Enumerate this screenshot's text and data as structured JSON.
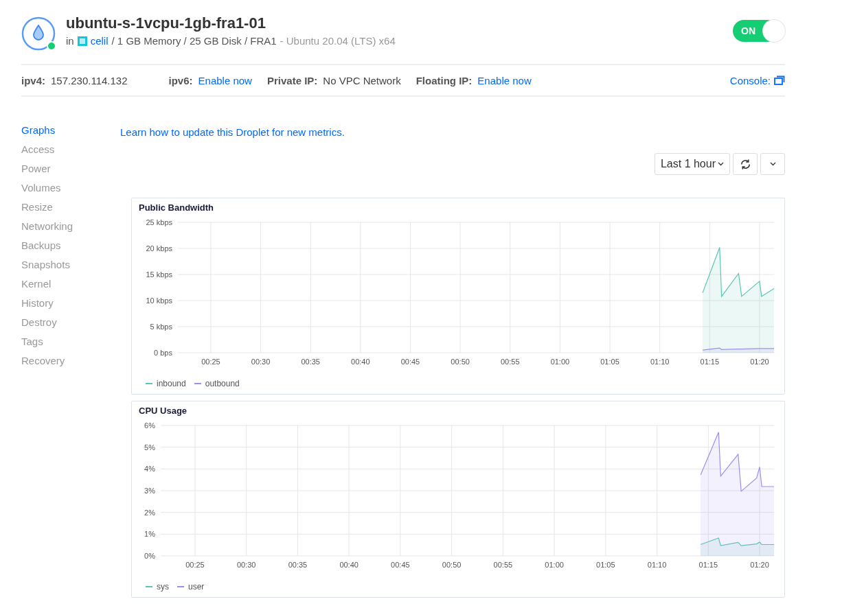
{
  "header": {
    "name": "ubuntu-s-1vcpu-1gb-fra1-01",
    "in_label": "in",
    "project": "celil",
    "specs": "/ 1 GB Memory / 25 GB Disk / FRA1",
    "image": "- Ubuntu 20.04 (LTS) x64",
    "power": {
      "label": "ON",
      "on": true
    }
  },
  "network": {
    "items": [
      {
        "label": "ipv4:",
        "value": "157.230.114.132",
        "kind": "text"
      },
      {
        "label": "ipv6:",
        "value": "Enable now",
        "kind": "link"
      },
      {
        "label": "Private IP:",
        "value": "No VPC Network",
        "kind": "text"
      },
      {
        "label": "Floating IP:",
        "value": "Enable now",
        "kind": "link"
      }
    ],
    "console": "Console:"
  },
  "sidebar": {
    "items": [
      {
        "label": "Graphs",
        "selected": true
      },
      {
        "label": "Access",
        "selected": false
      },
      {
        "label": "Power",
        "selected": false
      },
      {
        "label": "Volumes",
        "selected": false
      },
      {
        "label": "Resize",
        "selected": false
      },
      {
        "label": "Networking",
        "selected": false
      },
      {
        "label": "Backups",
        "selected": false
      },
      {
        "label": "Snapshots",
        "selected": false
      },
      {
        "label": "Kernel",
        "selected": false
      },
      {
        "label": "History",
        "selected": false
      },
      {
        "label": "Destroy",
        "selected": false
      },
      {
        "label": "Tags",
        "selected": false
      },
      {
        "label": "Recovery",
        "selected": false
      }
    ]
  },
  "main": {
    "update_link": "Learn how to update this Droplet for new metrics.",
    "range": "Last 1 hour",
    "charts": [
      {
        "chart_data": {
          "type": "area",
          "grid": true,
          "title": "Public Bandwidth",
          "x": [
            74.3,
            76.0,
            76.2,
            77.9,
            78.2,
            80.0,
            80.2,
            81.45
          ],
          "series": [
            {
              "name": "inbound",
              "color": "#5cc6b4",
              "values": [
                11.5,
                20.2,
                10.8,
                15.2,
                10.8,
                13.7,
                10.8,
                12.3
              ]
            },
            {
              "name": "outbound",
              "color": "#9d8ff0",
              "values": [
                0.5,
                0.9,
                0.6,
                0.7,
                0.7,
                0.8,
                0.8,
                0.8
              ]
            }
          ],
          "xlim": [
            21.7,
            81.45
          ],
          "ylim": [
            0,
            25
          ],
          "xticks": [
            {
              "value": 25,
              "label": "00:25"
            },
            {
              "value": 30,
              "label": "00:30"
            },
            {
              "value": 35,
              "label": "00:35"
            },
            {
              "value": 40,
              "label": "00:40"
            },
            {
              "value": 45,
              "label": "00:45"
            },
            {
              "value": 50,
              "label": "00:50"
            },
            {
              "value": 55,
              "label": "00:55"
            },
            {
              "value": 60,
              "label": "01:00"
            },
            {
              "value": 65,
              "label": "01:05"
            },
            {
              "value": 70,
              "label": "01:10"
            },
            {
              "value": 75,
              "label": "01:15"
            },
            {
              "value": 80,
              "label": "01:20"
            }
          ],
          "yticks": [
            {
              "value": 0,
              "label": "0 bps"
            },
            {
              "value": 5,
              "label": "5 kbps"
            },
            {
              "value": 10,
              "label": "10 kbps"
            },
            {
              "value": 15,
              "label": "15 kbps"
            },
            {
              "value": 20,
              "label": "20 kbps"
            },
            {
              "value": 25,
              "label": "25 kbps"
            }
          ]
        }
      },
      {
        "chart_data": {
          "type": "area",
          "grid": true,
          "title": "CPU Usage",
          "x": [
            74.25,
            76.0,
            76.2,
            77.9,
            78.2,
            79.7,
            80.0,
            80.2,
            81.4
          ],
          "series": [
            {
              "name": "sys",
              "color": "#5cc6b4",
              "values": [
                0.52,
                0.82,
                0.47,
                0.62,
                0.47,
                0.55,
                0.63,
                0.52,
                0.52
              ]
            },
            {
              "name": "user",
              "color": "#9d8ff0",
              "values": [
                3.73,
                5.69,
                3.67,
                4.67,
                2.97,
                3.58,
                4.09,
                3.19,
                3.19
              ]
            }
          ],
          "xlim": [
            21.66,
            81.4
          ],
          "ylim": [
            0,
            6
          ],
          "xticks": [
            {
              "value": 25,
              "label": "00:25"
            },
            {
              "value": 30,
              "label": "00:30"
            },
            {
              "value": 35,
              "label": "00:35"
            },
            {
              "value": 40,
              "label": "00:40"
            },
            {
              "value": 45,
              "label": "00:45"
            },
            {
              "value": 50,
              "label": "00:50"
            },
            {
              "value": 55,
              "label": "00:55"
            },
            {
              "value": 60,
              "label": "01:00"
            },
            {
              "value": 65,
              "label": "01:05"
            },
            {
              "value": 70,
              "label": "01:10"
            },
            {
              "value": 75,
              "label": "01:15"
            },
            {
              "value": 80,
              "label": "01:20"
            }
          ],
          "yticks": [
            {
              "value": 0,
              "label": "0%"
            },
            {
              "value": 1,
              "label": "1%"
            },
            {
              "value": 2,
              "label": "2%"
            },
            {
              "value": 3,
              "label": "3%"
            },
            {
              "value": 4,
              "label": "4%"
            },
            {
              "value": 5,
              "label": "5%"
            },
            {
              "value": 6,
              "label": "6%"
            }
          ]
        }
      }
    ]
  }
}
